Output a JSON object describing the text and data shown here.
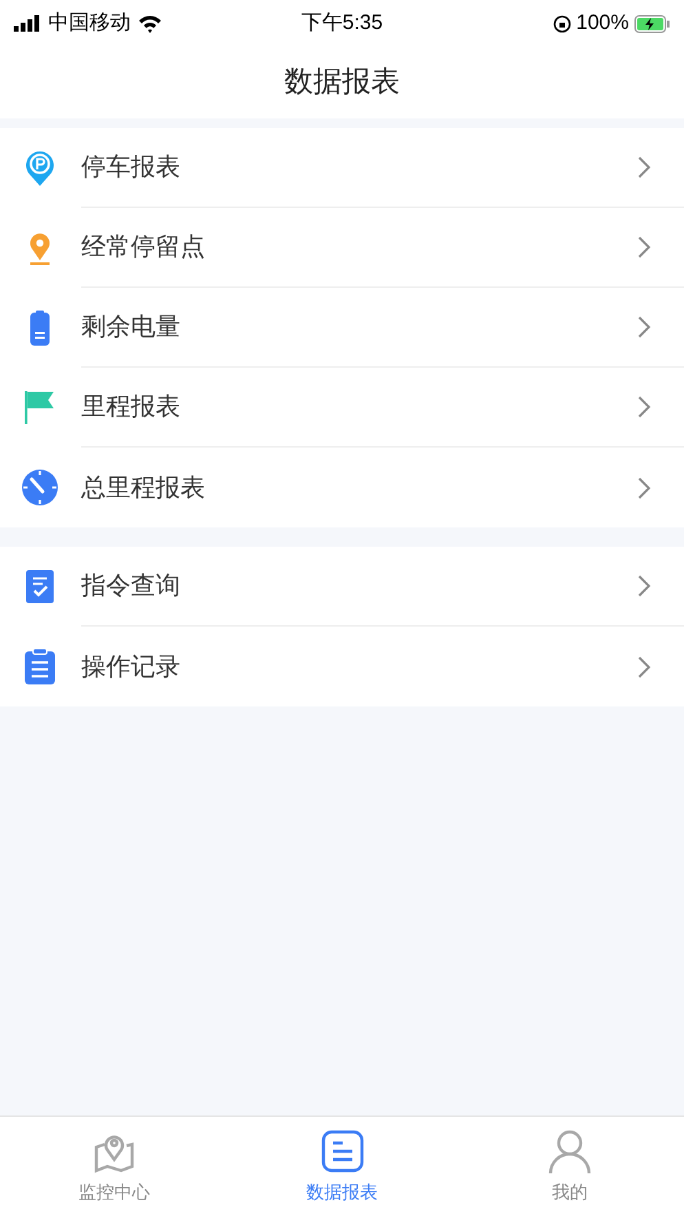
{
  "status_bar": {
    "carrier": "中国移动",
    "time": "下午5:35",
    "battery": "100%"
  },
  "header": {
    "title": "数据报表"
  },
  "groups": [
    {
      "items": [
        {
          "kind": "parking",
          "label": "停车报表"
        },
        {
          "kind": "pin",
          "label": "经常停留点"
        },
        {
          "kind": "battery",
          "label": "剩余电量"
        },
        {
          "kind": "flag",
          "label": "里程报表"
        },
        {
          "kind": "gauge",
          "label": "总里程报表"
        }
      ]
    },
    {
      "items": [
        {
          "kind": "checklist",
          "label": "指令查询"
        },
        {
          "kind": "clipboard",
          "label": "操作记录"
        }
      ]
    }
  ],
  "tab_bar": [
    {
      "kind": "map",
      "label": "监控中心",
      "selected": false
    },
    {
      "kind": "report",
      "label": "数据报表",
      "selected": true
    },
    {
      "kind": "person",
      "label": "我的",
      "selected": false
    }
  ]
}
